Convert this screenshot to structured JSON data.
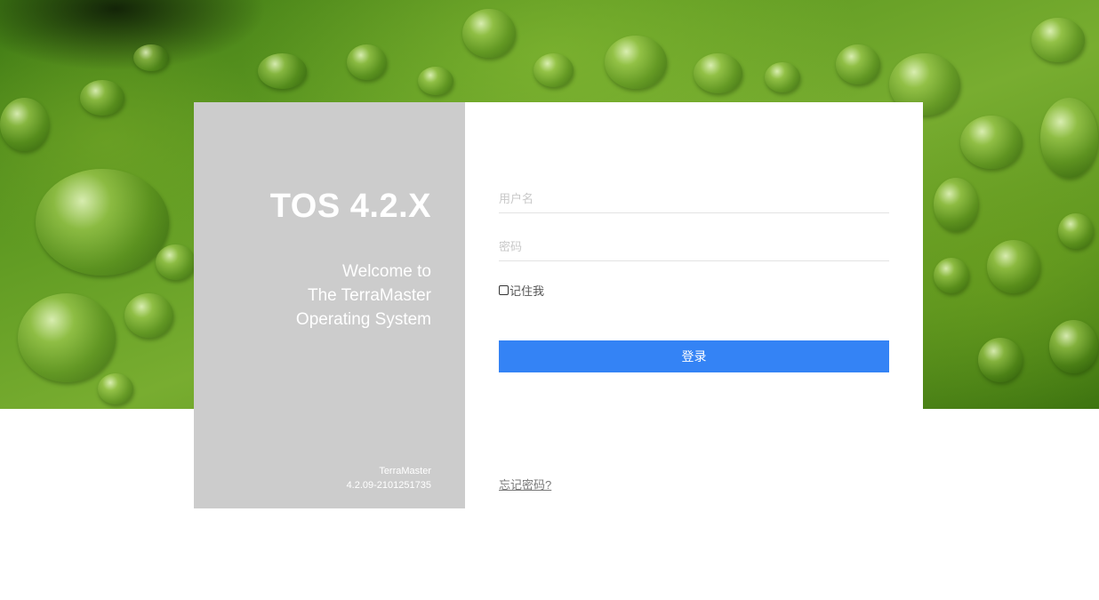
{
  "colors": {
    "panel_gray": "#cccccc",
    "primary_button": "#3483f5",
    "leaf_green": "#5f9a22"
  },
  "brand_panel": {
    "title": "TOS 4.2.X",
    "welcome_lines": [
      "Welcome to",
      "The TerraMaster",
      "Operating System"
    ],
    "vendor": "TerraMaster",
    "version": "4.2.09-2101251735"
  },
  "login_form": {
    "username_placeholder": "用户名",
    "username_value": "",
    "password_placeholder": "密码",
    "password_value": "",
    "remember_label": "记住我",
    "remember_checked": false,
    "login_label": "登录",
    "forgot_label": "忘记密码?"
  }
}
